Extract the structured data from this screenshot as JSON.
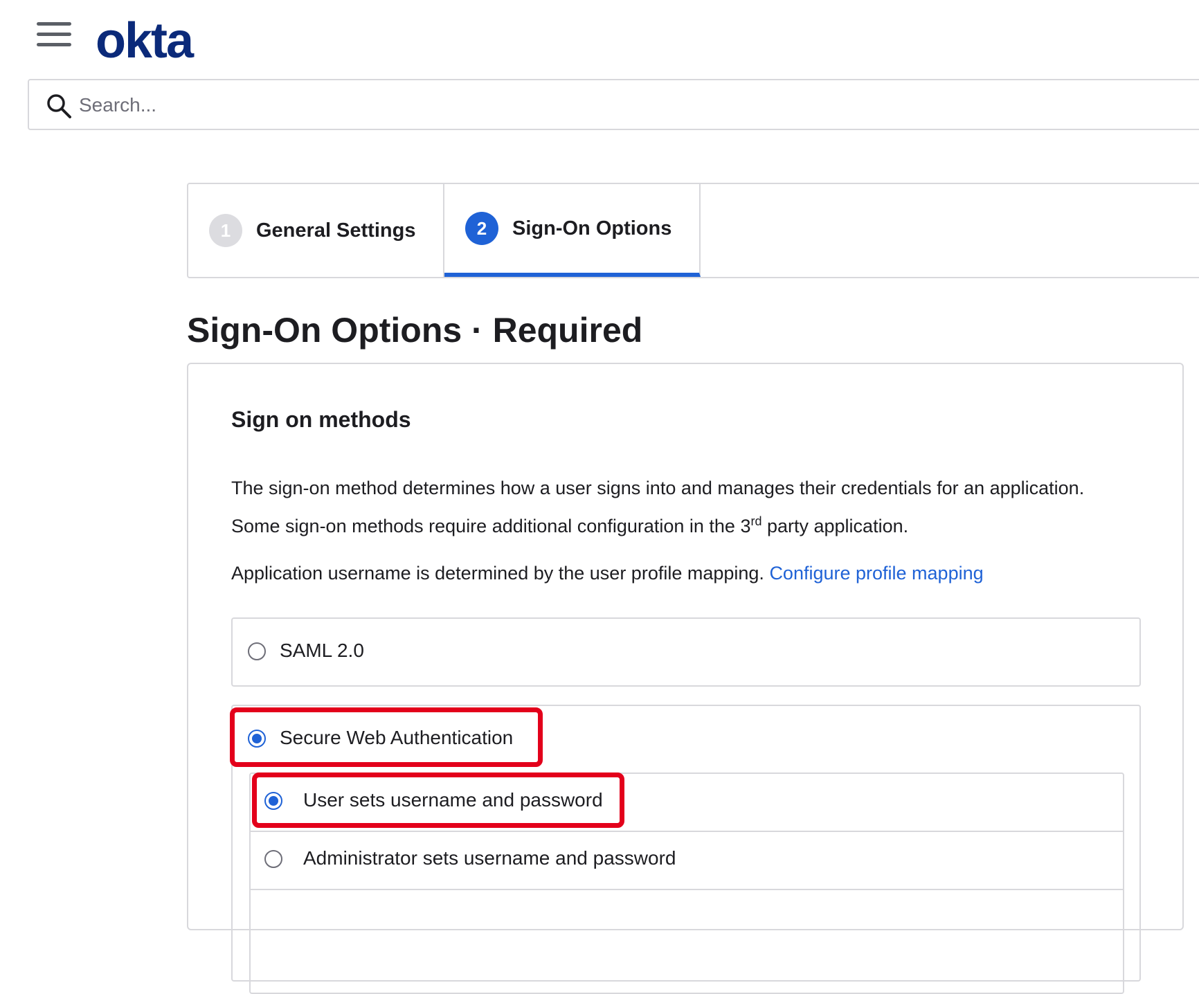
{
  "header": {
    "menu_icon": "hamburger-menu-icon",
    "logo_text": "okta",
    "search": {
      "placeholder": "Search...",
      "value": "",
      "icon": "search-icon"
    }
  },
  "steps": [
    {
      "number": "1",
      "label": "General Settings",
      "active": false
    },
    {
      "number": "2",
      "label": "Sign-On Options",
      "active": true
    }
  ],
  "page": {
    "title": "Sign-On Options · Required"
  },
  "card": {
    "title": "Sign on methods",
    "description_part1": "The sign-on method determines how a user signs into and manages their credentials for an application. Some sign-on methods require additional configuration in the 3",
    "description_sup": "rd",
    "description_part2": " party application.",
    "mapping_text": "Application username is determined by the user profile mapping. ",
    "mapping_link": "Configure profile mapping"
  },
  "options": {
    "saml": {
      "label": "SAML 2.0",
      "selected": false
    },
    "swa": {
      "label": "Secure Web Authentication",
      "selected": true,
      "sub_options": [
        {
          "label": "User sets username and password",
          "selected": true
        },
        {
          "label": "Administrator sets username and password",
          "selected": false
        }
      ]
    }
  },
  "colors": {
    "accent": "#1f62d6",
    "logo": "#0b2a7a",
    "highlight": "#e3001b"
  }
}
